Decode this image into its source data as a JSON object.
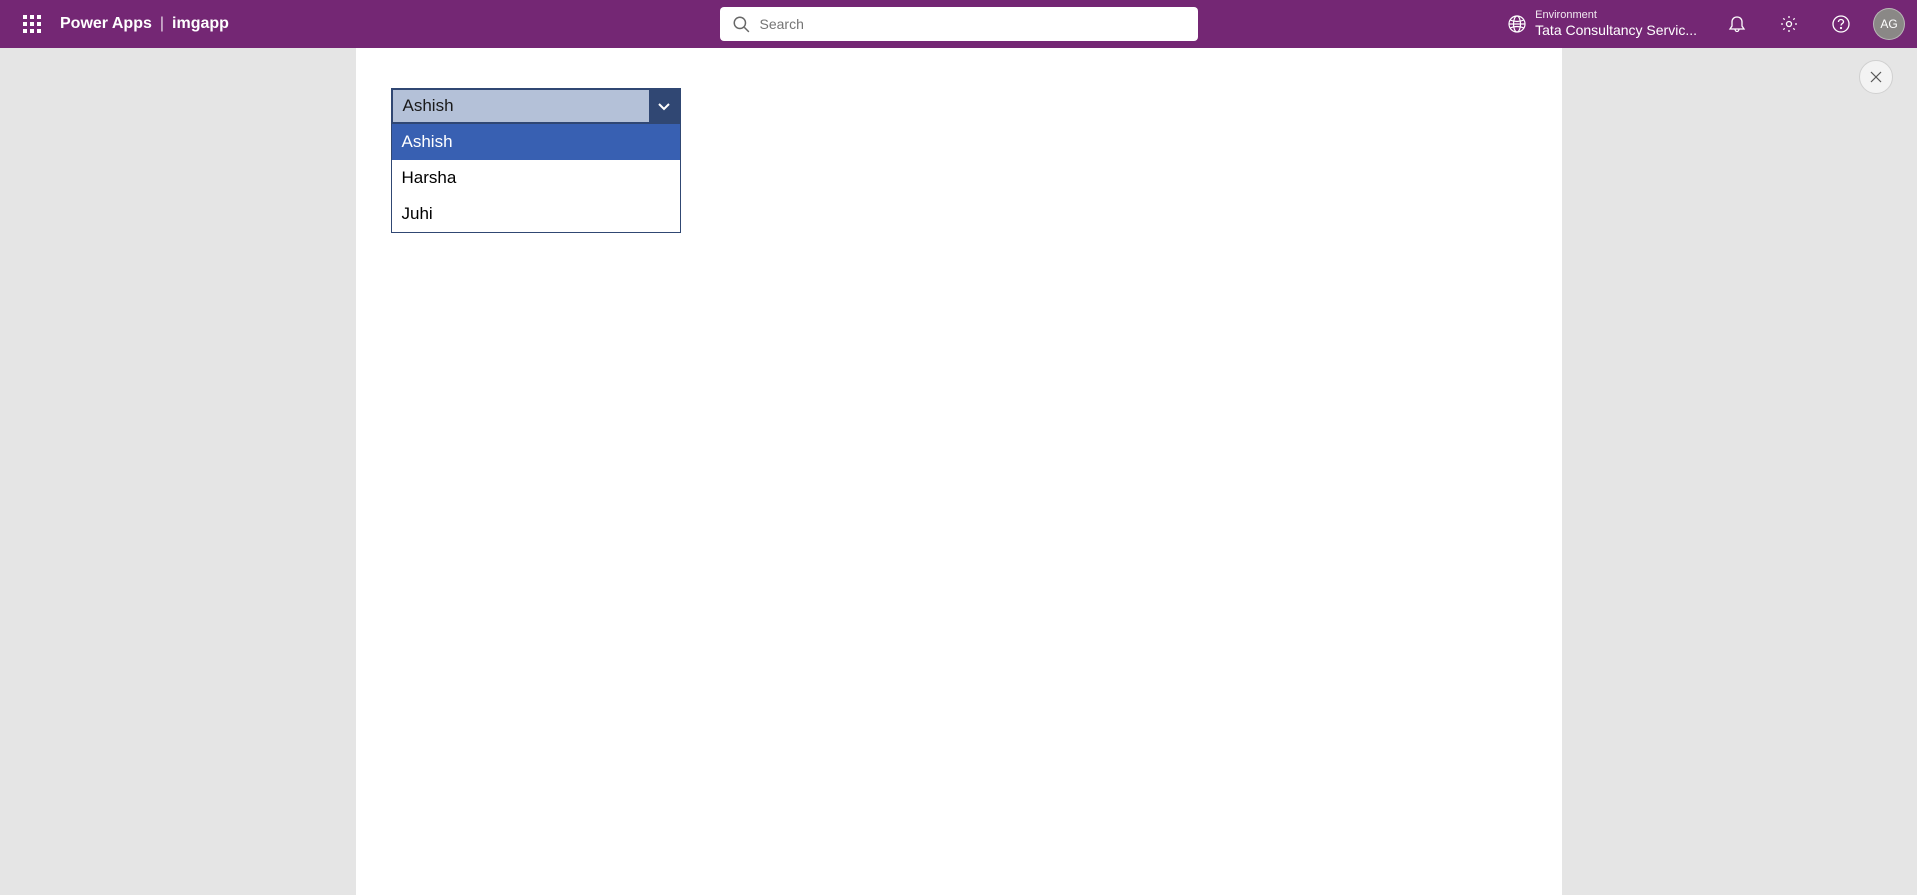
{
  "header": {
    "product_name": "Power Apps",
    "separator": "|",
    "app_name": "imgapp",
    "search_placeholder": "Search",
    "environment_label": "Environment",
    "environment_value": "Tata Consultancy Servic...",
    "avatar_initials": "AG"
  },
  "dropdown": {
    "selected_value": "Ashish",
    "options": [
      "Ashish",
      "Harsha",
      "Juhi"
    ],
    "selected_index": 0
  }
}
